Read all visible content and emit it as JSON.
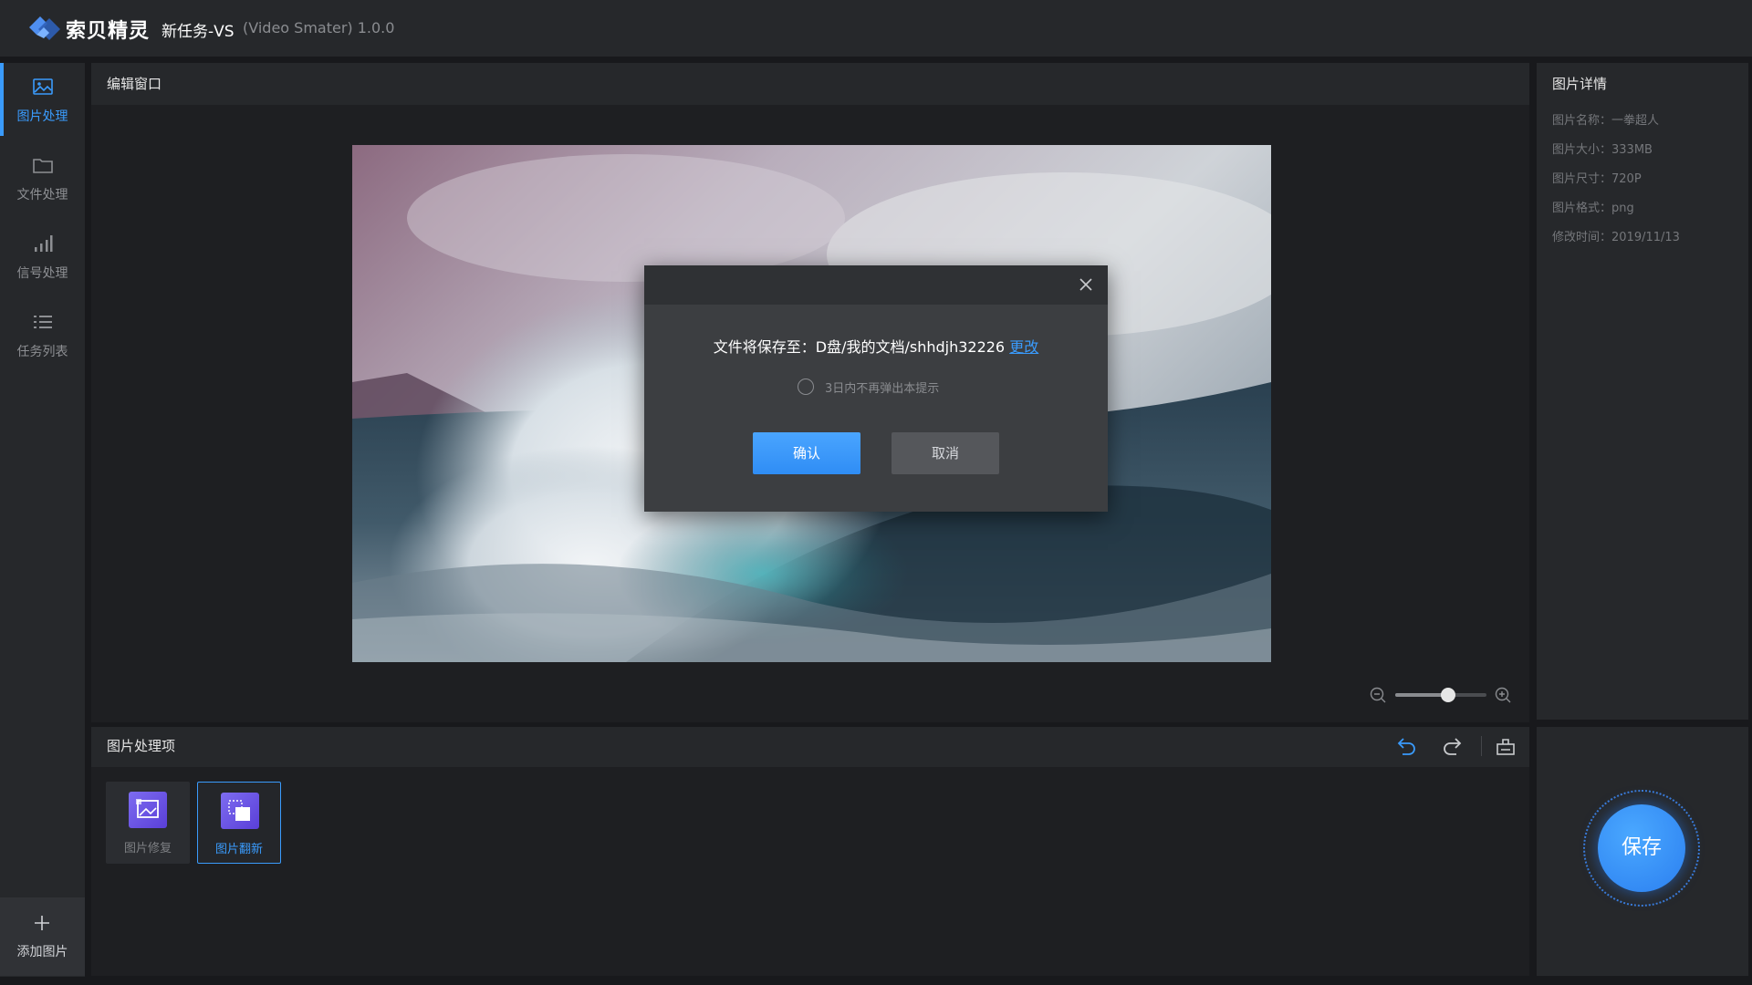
{
  "app": {
    "brand": "索贝精灵",
    "task_title": "新任务-VS",
    "task_subtitle": "(Video Smater) 1.0.0"
  },
  "sidebar": {
    "items": [
      {
        "label": "图片处理",
        "icon": "image-icon",
        "active": true
      },
      {
        "label": "文件处理",
        "icon": "folder-icon",
        "active": false
      },
      {
        "label": "信号处理",
        "icon": "signal-icon",
        "active": false
      },
      {
        "label": "任务列表",
        "icon": "list-icon",
        "active": false
      }
    ],
    "add_label": "添加图片"
  },
  "editor": {
    "title": "编辑窗口",
    "zoom_level": 0.58
  },
  "details": {
    "title": "图片详情",
    "rows": [
      "图片名称：一拳超人",
      "图片大小：333MB",
      "图片尺寸：720P",
      "图片格式：png",
      "修改时间：2019/11/13"
    ]
  },
  "processing": {
    "title": "图片处理项",
    "tools": [
      {
        "label": "图片修复",
        "active": false
      },
      {
        "label": "图片翻新",
        "active": true
      }
    ]
  },
  "save_label": "保存",
  "modal": {
    "message": "文件将保存至：D盘/我的文档/shhdjh32226",
    "change_link": "更改",
    "checkbox_label": "3日内不再弹出本提示",
    "confirm_label": "确认",
    "cancel_label": "取消"
  },
  "colors": {
    "accent": "#3a9bfc",
    "bg": "#18191c",
    "panel": "#26282b"
  }
}
